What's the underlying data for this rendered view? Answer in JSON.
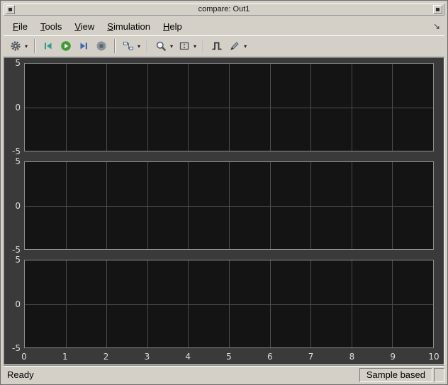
{
  "icons": {
    "caret": "▾",
    "dock_arrow": "↘"
  },
  "window": {
    "title": "compare: Out1",
    "controls": [
      {
        "name": "window-menu-button",
        "icon": "window-menu-icon"
      },
      {
        "name": "window-close-button",
        "icon": "window-close-icon"
      }
    ]
  },
  "menubar": {
    "items": [
      {
        "name": "file",
        "mnemonic": "F",
        "rest": "ile"
      },
      {
        "name": "tools",
        "mnemonic": "T",
        "rest": "ools"
      },
      {
        "name": "view",
        "mnemonic": "V",
        "rest": "iew"
      },
      {
        "name": "simulation",
        "mnemonic": "S",
        "rest": "imulation"
      },
      {
        "name": "help",
        "mnemonic": "H",
        "rest": "elp"
      }
    ]
  },
  "toolbar": {
    "buttons": [
      {
        "name": "settings-button",
        "icon": "gear-icon",
        "dropdown": true
      },
      {
        "name": "step-back-button",
        "icon": "step-back-icon",
        "dropdown": false
      },
      {
        "name": "run-button",
        "icon": "run-icon",
        "dropdown": false
      },
      {
        "name": "step-forward-button",
        "icon": "step-forward-icon",
        "dropdown": false
      },
      {
        "name": "stop-button",
        "icon": "stop-icon",
        "dropdown": false
      },
      {
        "name": "simulink-block-button",
        "icon": "blocks-icon",
        "dropdown": true
      },
      {
        "name": "zoom-button",
        "icon": "magnifier-icon",
        "dropdown": true
      },
      {
        "name": "scale-axes-button",
        "icon": "scale-axes-icon",
        "dropdown": true
      },
      {
        "name": "triggers-button",
        "icon": "trigger-icon",
        "dropdown": false
      },
      {
        "name": "measurements-button",
        "icon": "brush-icon",
        "dropdown": true
      }
    ]
  },
  "chart_data": {
    "type": "line",
    "subplots": 3,
    "title": "",
    "xlabel": "",
    "ylabel": "",
    "x": {
      "min": 0,
      "max": 10,
      "ticks": [
        0,
        1,
        2,
        3,
        4,
        5,
        6,
        7,
        8,
        9,
        10
      ]
    },
    "y": {
      "min": -5,
      "max": 5,
      "ticks": [
        5,
        0,
        -5
      ]
    },
    "series": [],
    "grid": true,
    "legend": false,
    "colors": {
      "figure_bg": "#3a3a3a",
      "axes_bg": "#141414",
      "grid_line": "#4c4c4c",
      "axes_border": "#8f8f8f",
      "tick_label": "#dcdcdc"
    }
  },
  "statusbar": {
    "status": "Ready",
    "sample_mode": "Sample based"
  },
  "ui_colors": {
    "chrome": "#d4d0c8",
    "run_green": "#3f9c35",
    "step_blue": "#3a66b0",
    "step_back_teal": "#2a9d8f",
    "stop_gray": "#8b949c"
  }
}
